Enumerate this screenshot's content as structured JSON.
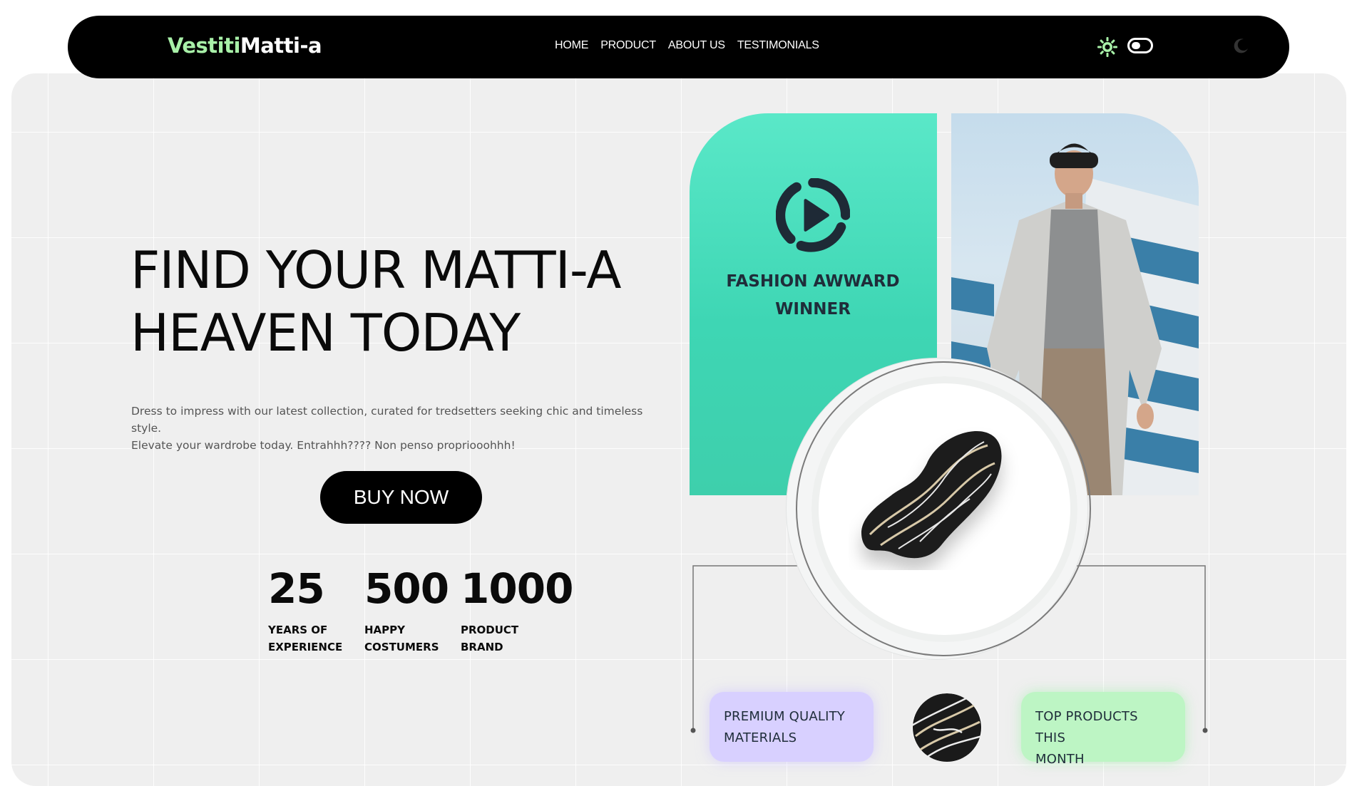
{
  "header": {
    "logo_part1": "Vestiti",
    "logo_part2": "Matti-a",
    "nav": [
      "HOME",
      "PRODUCT",
      "ABOUT US",
      "TESTIMONIALS"
    ],
    "icons": [
      "sun-icon",
      "toggle-icon",
      "moon-icon"
    ]
  },
  "hero": {
    "title_line1": "FIND YOUR MATTI-A",
    "title_line2": "HEAVEN TODAY",
    "description_line1": "Dress to impress with our latest collection, curated for tredsetters seeking chic and timeless style.",
    "description_line2": "Elevate your wardrobe today. Entrahhh???? Non penso propriooohhh!",
    "cta": "BUY NOW"
  },
  "stats": [
    {
      "value": "25",
      "label": "YEARS OF\nEXPERIENCE"
    },
    {
      "value": "500",
      "label": "HAPPY\nCOSTUMERS"
    },
    {
      "value": "1000",
      "label": "PRODUCT\nBRAND"
    }
  ],
  "award": {
    "text": "FASHION AWWARD\nWINNER",
    "icon": "play-circle-icon"
  },
  "features": {
    "left": "PREMIUM QUALITY\nMATERIALS",
    "right": "TOP PRODUCTS THIS\nMONTH"
  },
  "colors": {
    "accent_green": "#a8f0a8",
    "card_teal": "#4ee0c0",
    "card_purple": "#d8d0ff",
    "card_mint": "#bdf5c4",
    "dark": "#000000"
  }
}
